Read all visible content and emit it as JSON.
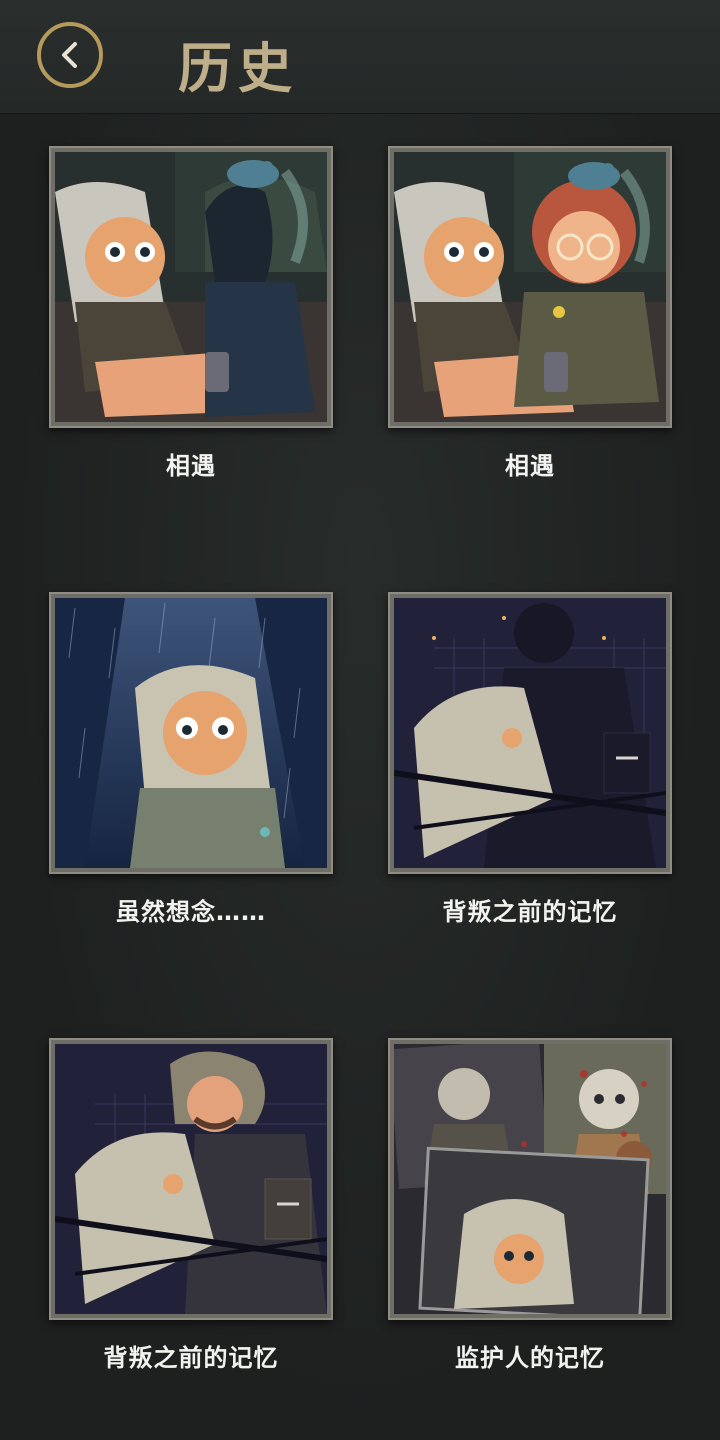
{
  "header": {
    "title": "历史",
    "back_icon": "chevron-left-icon"
  },
  "colors": {
    "background": "#1d201f",
    "header": "#2a2f2e",
    "accent_gold": "#b59a5c",
    "title": "#bfae8a",
    "caption": "#f2f2ee"
  },
  "cards": [
    {
      "caption": "相遇",
      "scene": "two characters sitting on a bench at night, dark shadowy figure with a blue bird on head"
    },
    {
      "caption": "相遇",
      "scene": "two characters sitting on a bench at night, red-haired girl with round glasses and a blue bird"
    },
    {
      "caption": "虽然想念……",
      "scene": "crying grey-haired child standing in the rain under a spotlight"
    },
    {
      "caption": "背叛之前的记忆",
      "scene": "shadow figure hugging a grey-haired child in front of a chain-link fence"
    },
    {
      "caption": "背叛之前的记忆",
      "scene": "curly-haired bearded man hugging a grey-haired child in front of a fence"
    },
    {
      "caption": "监护人的记忆",
      "scene": "collage of photographs of a grey-haired child with a teddy bear and blood stains"
    }
  ]
}
